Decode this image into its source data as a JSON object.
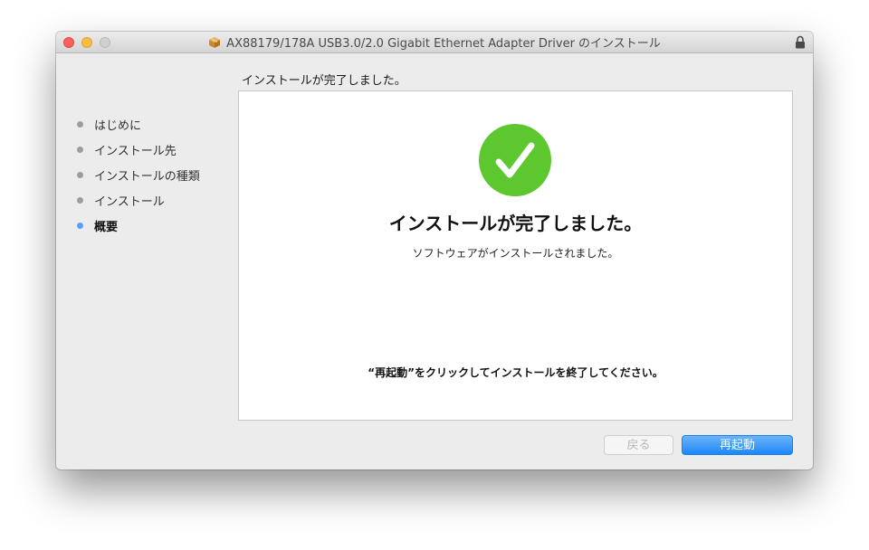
{
  "window": {
    "title": "AX88179/178A USB3.0/2.0 Gigabit Ethernet Adapter Driver のインストール",
    "title_icon": "package-icon",
    "lock_icon": "lock-icon"
  },
  "header": {
    "status": "インストールが完了しました。"
  },
  "sidebar": {
    "items": [
      {
        "label": "はじめに",
        "active": false
      },
      {
        "label": "インストール先",
        "active": false
      },
      {
        "label": "インストールの種類",
        "active": false
      },
      {
        "label": "インストール",
        "active": false
      },
      {
        "label": "概要",
        "active": true
      }
    ]
  },
  "main": {
    "success_icon": "checkmark-icon",
    "title": "インストールが完了しました。",
    "subtitle": "ソフトウェアがインストールされました。",
    "note": "“再起動”をクリックしてインストールを終了してください。"
  },
  "buttons": {
    "back": "戻る",
    "restart": "再起動"
  },
  "colors": {
    "success": "#5cc72e",
    "accent": "#1c87f8",
    "active_bullet": "#4ea5f7",
    "inactive_bullet": "#9d9d9d"
  }
}
